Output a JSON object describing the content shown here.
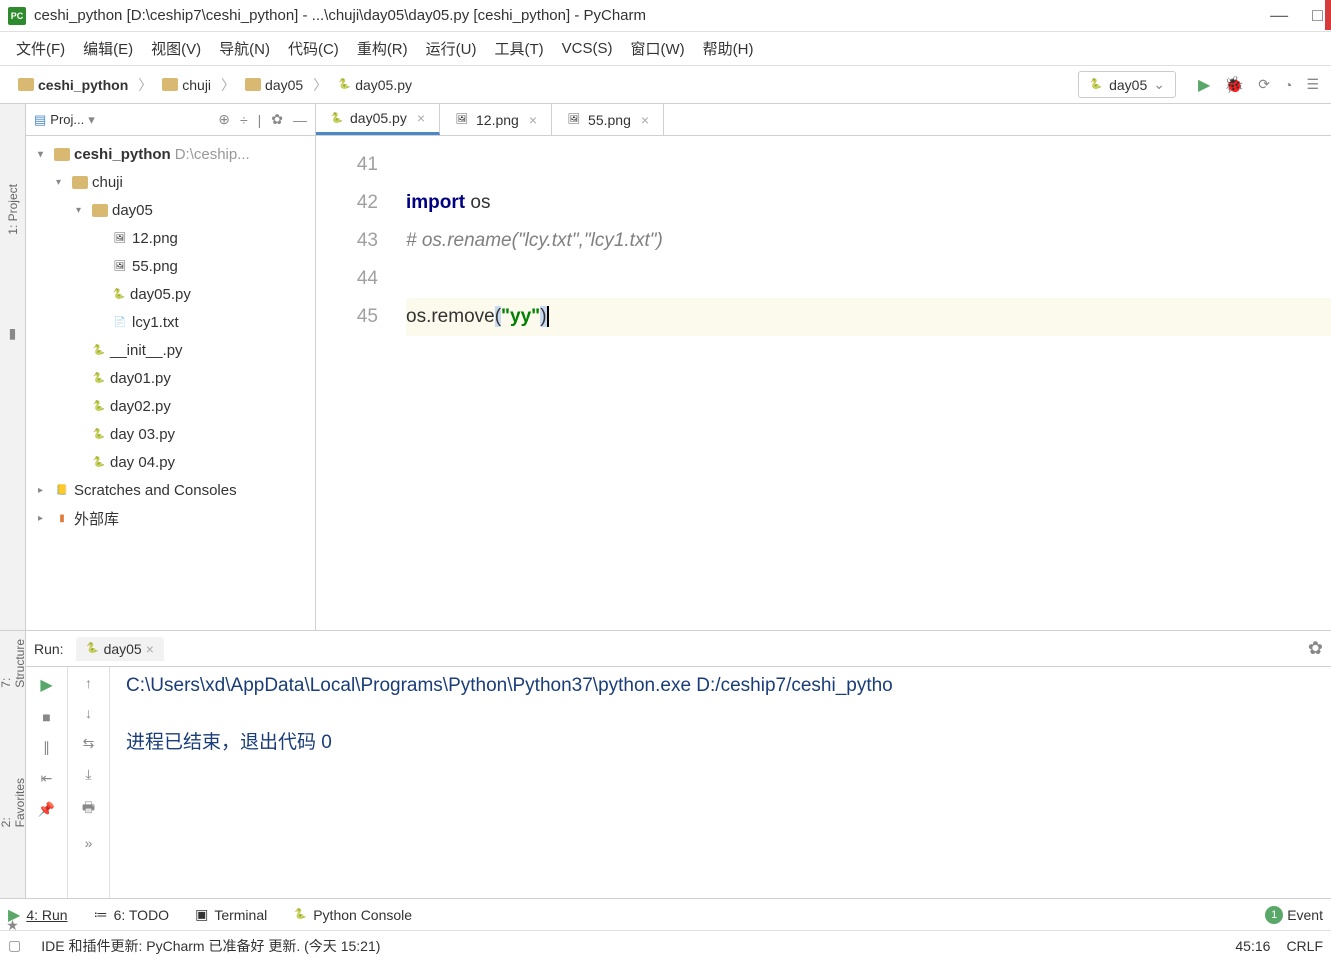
{
  "window": {
    "title": "ceshi_python [D:\\ceship7\\ceshi_python] - ...\\chuji\\day05\\day05.py [ceshi_python] - PyCharm"
  },
  "menu": {
    "file": "文件(F)",
    "edit": "编辑(E)",
    "view": "视图(V)",
    "navigate": "导航(N)",
    "code": "代码(C)",
    "refactor": "重构(R)",
    "run": "运行(U)",
    "tools": "工具(T)",
    "vcs": "VCS(S)",
    "window": "窗口(W)",
    "help": "帮助(H)"
  },
  "breadcrumb": [
    "ceshi_python",
    "chuji",
    "day05",
    "day05.py"
  ],
  "runConfig": {
    "selected": "day05"
  },
  "projectPanel": {
    "title": "Proj...",
    "tree": {
      "root": "ceshi_python",
      "rootPath": "D:\\ceship...",
      "chuji": "chuji",
      "day05": "day05",
      "files": [
        "12.png",
        "55.png",
        "day05.py",
        "lcy1.txt"
      ],
      "siblings": [
        "__init__.py",
        "day01.py",
        "day02.py",
        "day 03.py",
        "day 04.py"
      ],
      "scratches": "Scratches and Consoles",
      "external": "外部库"
    }
  },
  "editor": {
    "tabs": [
      {
        "label": "day05.py",
        "active": true
      },
      {
        "label": "12.png",
        "active": false
      },
      {
        "label": "55.png",
        "active": false
      }
    ],
    "gutter": [
      "41",
      "42",
      "43",
      "44",
      "45"
    ],
    "code": {
      "import_kw": "import",
      "import_mod": " os",
      "comment": "# os.rename(\"lcy.txt\",\"lcy1.txt\")",
      "l45_pre": "os.remove",
      "l45_open": "(",
      "l45_str": "\"yy\"",
      "l45_close": ")"
    }
  },
  "railLabels": {
    "project": "1: Project",
    "structure": "7: Structure",
    "favorites": "2: Favorites"
  },
  "run": {
    "label": "Run:",
    "tab": "day05",
    "line1": "C:\\Users\\xd\\AppData\\Local\\Programs\\Python\\Python37\\python.exe D:/ceship7/ceshi_pytho",
    "line2": "进程已结束，退出代码 0"
  },
  "toolWindows": {
    "run": "4: Run",
    "todo": "6: TODO",
    "terminal": "Terminal",
    "python": "Python Console",
    "event": "Event"
  },
  "status": {
    "msg": "IDE 和插件更新: PyCharm 已准备好 更新. (今天 15:21)",
    "pos": "45:16",
    "enc": "CRLF"
  }
}
